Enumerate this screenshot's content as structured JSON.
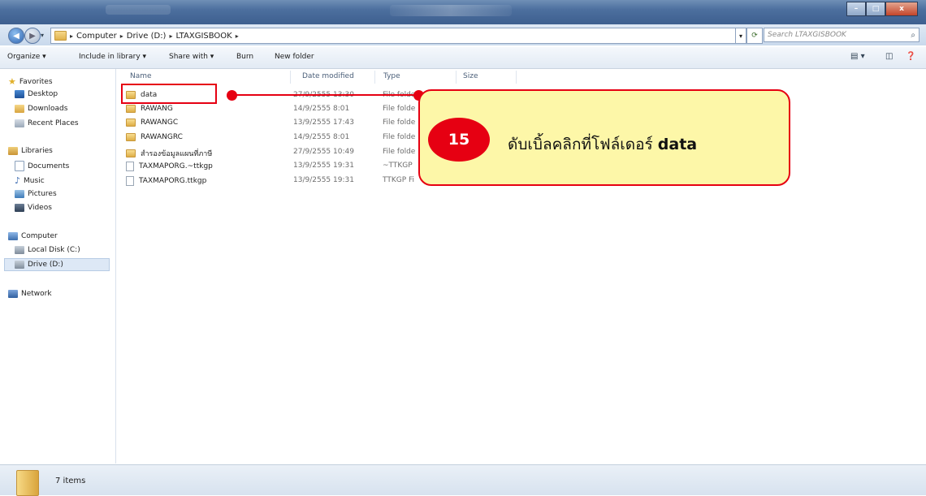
{
  "window": {
    "controls": {
      "minimize": "–",
      "maximize": "□",
      "close": "x"
    }
  },
  "address_bar": {
    "breadcrumbs": [
      "Computer",
      "Drive (D:)",
      "LTAXGISBOOK"
    ],
    "search_placeholder": "Search LTAXGISBOOK"
  },
  "toolbar": {
    "organize": "Organize ▾",
    "include_in_library": "Include in library ▾",
    "share_with": "Share with ▾",
    "burn": "Burn",
    "new_folder": "New folder"
  },
  "sidebar": {
    "favorites": "Favorites",
    "desktop": "Desktop",
    "downloads": "Downloads",
    "recent_places": "Recent Places",
    "libraries": "Libraries",
    "documents": "Documents",
    "music": "Music",
    "pictures": "Pictures",
    "videos": "Videos",
    "computer": "Computer",
    "local_disk": "Local Disk (C:)",
    "drive_d": "Drive (D:)",
    "network": "Network"
  },
  "columns": {
    "name": "Name",
    "date_modified": "Date modified",
    "type": "Type",
    "size": "Size"
  },
  "files": [
    {
      "name": "data",
      "date": "27/9/2555 13:30",
      "type": "File folder",
      "kind": "folder"
    },
    {
      "name": "RAWANG",
      "date": "14/9/2555 8:01",
      "type": "File folde",
      "kind": "folder"
    },
    {
      "name": "RAWANGC",
      "date": "13/9/2555 17:43",
      "type": "File folde",
      "kind": "folder"
    },
    {
      "name": "RAWANGRC",
      "date": "14/9/2555 8:01",
      "type": "File folde",
      "kind": "folder"
    },
    {
      "name": "สำรองข้อมูลแผนที่ภาษี",
      "date": "27/9/2555 10:49",
      "type": "File folde",
      "kind": "folder"
    },
    {
      "name": "TAXMAPORG.~ttkgp",
      "date": "13/9/2555 19:31",
      "type": "~TTKGP",
      "kind": "file"
    },
    {
      "name": "TAXMAPORG.ttkgp",
      "date": "13/9/2555 19:31",
      "type": "TTKGP Fi",
      "kind": "file"
    }
  ],
  "callout": {
    "step": "15",
    "text": "ดับเบิ้ลคลิกที่โฟล์เดอร์",
    "target": "data",
    "colors": {
      "accent": "#e60012",
      "fill": "#fdf7a8"
    }
  },
  "status": {
    "items": "7 items"
  }
}
